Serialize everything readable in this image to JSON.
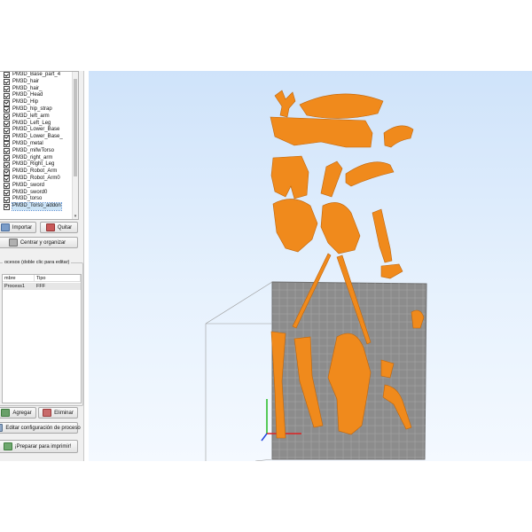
{
  "parts": [
    "PM3D_Base_part_4",
    "PM3D_hair",
    "PM3D_hair_",
    "PM3D_Head",
    "PM3D_Hip",
    "PM3D_hip_strap",
    "PM3D_left_arm",
    "PM3D_Left_Leg",
    "PM3D_Lower_Base",
    "PM3D_Lower_Base_",
    "PM3D_metal",
    "PM3D_mifwTorso",
    "PM3D_right_arm",
    "PM3D_Right_Leg",
    "PM3D_Robot_Arm",
    "PM3D_Robot_Arm0",
    "PM3D_sword",
    "PM3D_sword0",
    "PM3D_torso",
    "PM3D_Torso_addon"
  ],
  "buttons": {
    "import": "Importar",
    "remove": "Quitar",
    "center": "Centrar y organizar",
    "add": "Agregar",
    "delete": "Eliminar",
    "edit": "Editar configuración de proceso",
    "print": "¡Preparar para imprimir!"
  },
  "processes": {
    "title": "ocesos (doble clic para editar)",
    "columns": [
      "mbre",
      "Tipo"
    ],
    "rows": [
      {
        "name": "Process1",
        "type": "FFF"
      }
    ]
  },
  "colors": {
    "model": "#f08a1c",
    "bed": "#8c8c8c",
    "sky_top": "#cfe3fa"
  }
}
